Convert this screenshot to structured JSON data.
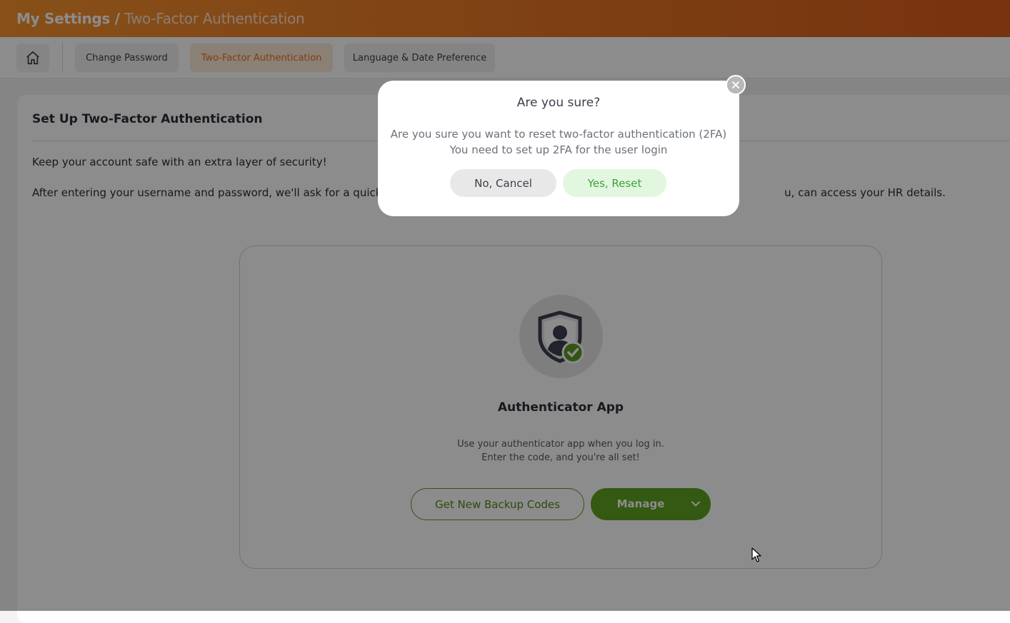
{
  "header": {
    "title": "My Settings /",
    "subtitle": "Two-Factor Authentication"
  },
  "tabs": [
    {
      "label": "Change Password",
      "active": false
    },
    {
      "label": "Two-Factor Authentication",
      "active": true
    },
    {
      "label": "Language & Date Preference",
      "active": false
    }
  ],
  "home_icon": "home-icon",
  "main": {
    "title": "Set Up Two-Factor Authentication",
    "intro_line1": "Keep your account safe with an extra layer of security!",
    "intro_line2_start": "After entering your username and password, we'll ask for a quick v",
    "intro_line2_end": "u, can access your HR details."
  },
  "method": {
    "icon": "shield-user-check-icon",
    "name": "Authenticator App",
    "desc_line1": "Use your authenticator app when you log in.",
    "desc_line2": "Enter the code, and you're all set!",
    "backup_button": "Get New Backup Codes",
    "manage_button": "Manage"
  },
  "modal": {
    "title": "Are you sure?",
    "message_line1": "Are you sure you want to reset two-factor authentication (2FA)",
    "message_line2": "You need to set up 2FA for the user login",
    "cancel_button": "No, Cancel",
    "confirm_button": "Yes, Reset"
  },
  "colors": {
    "brand_orange": "#e57524",
    "accent_green": "#5fa222",
    "confirm_green_text": "#3aa43a"
  }
}
